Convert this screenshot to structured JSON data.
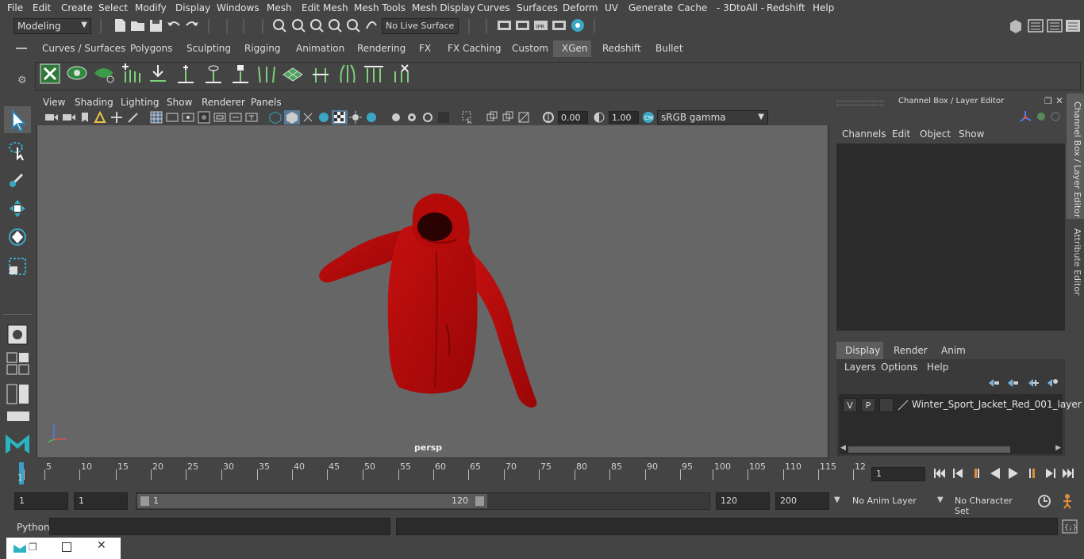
{
  "menu": [
    "File",
    "Edit",
    "Create",
    "Select",
    "Modify",
    "Display",
    "Windows",
    "Mesh",
    "Edit Mesh",
    "Mesh Tools",
    "Mesh Display",
    "Curves",
    "Surfaces",
    "Deform",
    "UV",
    "Generate",
    "Cache",
    "- 3DtoAll -",
    "Redshift",
    "Help"
  ],
  "status": {
    "mode": "Modeling",
    "live_surface": "No Live Surface"
  },
  "shelf_tabs": [
    "Curves / Surfaces",
    "Polygons",
    "Sculpting",
    "Rigging",
    "Animation",
    "Rendering",
    "FX",
    "FX Caching",
    "Custom",
    "XGen",
    "Redshift",
    "Bullet"
  ],
  "active_shelf_tab": "XGen",
  "viewport": {
    "menu": [
      "View",
      "Shading",
      "Lighting",
      "Show",
      "Renderer",
      "Panels"
    ],
    "exposure": "0.00",
    "gamma": "1.00",
    "color_space": "sRGB gamma",
    "camera_label": "persp"
  },
  "channel_box": {
    "title": "Channel Box / Layer Editor",
    "menu": [
      "Channels",
      "Edit",
      "Object",
      "Show"
    ],
    "side_tabs": [
      "Channel Box / Layer Editor",
      "Attribute Editor"
    ]
  },
  "layer_editor": {
    "tabs": [
      "Display",
      "Render",
      "Anim"
    ],
    "menu": [
      "Layers",
      "Options",
      "Help"
    ],
    "layer": {
      "v": "V",
      "p": "P",
      "name": "Winter_Sport_Jacket_Red_001_layer"
    }
  },
  "timeline": {
    "ticks": [
      "1",
      "5",
      "10",
      "15",
      "20",
      "25",
      "30",
      "35",
      "40",
      "45",
      "50",
      "55",
      "60",
      "65",
      "70",
      "75",
      "80",
      "85",
      "90",
      "95",
      "100",
      "105",
      "110",
      "115",
      "12"
    ],
    "current_frame": "1"
  },
  "range": {
    "start": "1",
    "playback_start": "1",
    "slider_start": "1",
    "slider_end": "120",
    "playback_end": "120",
    "end": "200",
    "anim_layer": "No Anim Layer",
    "character_set": "No Character Set"
  },
  "command": {
    "label": "Python"
  },
  "colors": {
    "jacket": "#b30a0a",
    "active_tab": "#5d5d5d",
    "viewport_bg": "#666666"
  }
}
